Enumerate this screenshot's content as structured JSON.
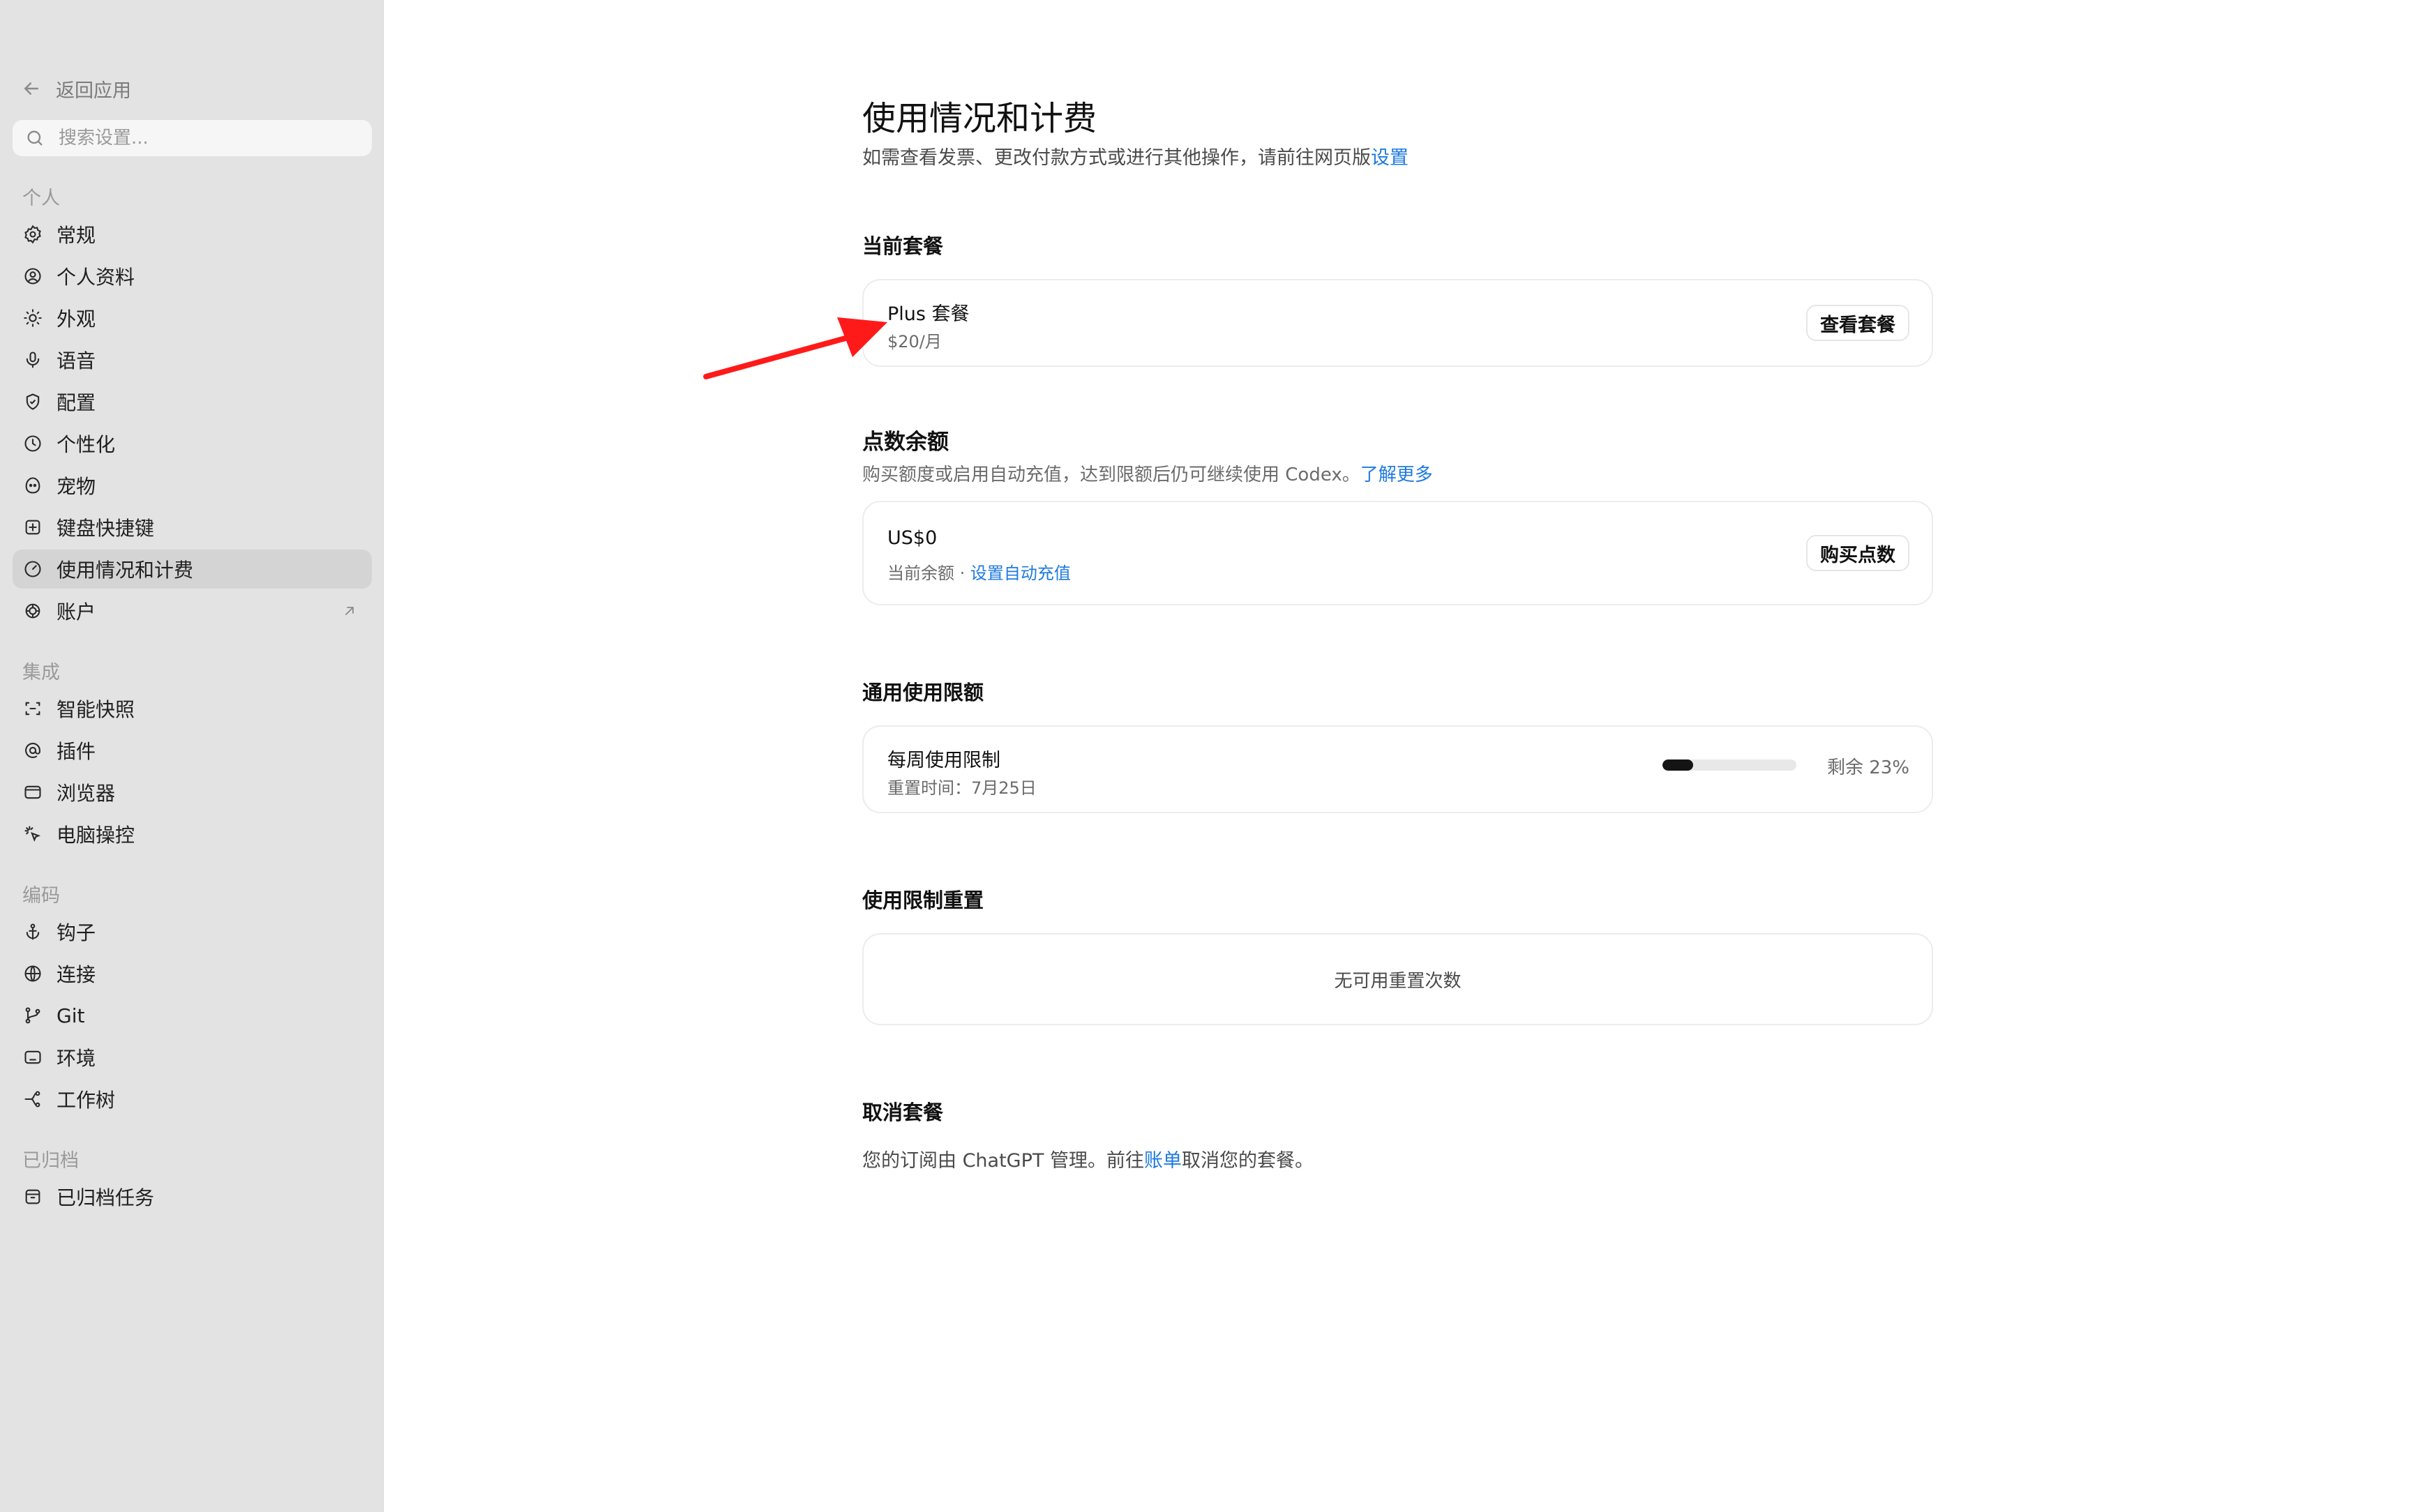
{
  "sidebar": {
    "back_label": "返回应用",
    "search_placeholder": "搜索设置...",
    "sections": {
      "personal": "个人",
      "integrations": "集成",
      "coding": "编码",
      "archived": "已归档"
    },
    "items": {
      "general": "常规",
      "profile": "个人资料",
      "appearance": "外观",
      "voice": "语音",
      "config": "配置",
      "personalization": "个性化",
      "pets": "宠物",
      "shortcuts": "键盘快捷键",
      "usage": "使用情况和计费",
      "account": "账户",
      "snapshots": "智能快照",
      "plugins": "插件",
      "browser": "浏览器",
      "computer_use": "电脑操控",
      "hooks": "钩子",
      "connections": "连接",
      "git": "Git",
      "environments": "环境",
      "worktrees": "工作树",
      "archived_tasks": "已归档任务"
    }
  },
  "main": {
    "title": "使用情况和计费",
    "subtitle": "如需查看发票、更改付款方式或进行其他操作，请前往网页版",
    "subtitle_link": "设置",
    "plan": {
      "heading": "当前套餐",
      "name": "Plus 套餐",
      "price": "$20/月",
      "button": "查看套餐"
    },
    "credits": {
      "heading": "点数余额",
      "desc": "购买额度或启用自动充值，达到限额后仍可继续使用 Codex。",
      "desc_link": "了解更多",
      "balance": "US$0",
      "balance_label": "当前余额 · ",
      "auto_link": "设置自动充值",
      "button": "购买点数"
    },
    "limits": {
      "heading": "通用使用限额",
      "weekly_title": "每周使用限制",
      "reset_label": "重置时间：7月25日",
      "remaining_label": "剩余 23%",
      "used_fraction": 0.23
    },
    "resets": {
      "heading": "使用限制重置",
      "empty": "无可用重置次数"
    },
    "cancel": {
      "heading": "取消套餐",
      "text_before": "您的订阅由 ChatGPT 管理。前往",
      "link": "账单",
      "text_after": "取消您的套餐。"
    }
  },
  "colors": {
    "link": "#1f7ae0",
    "annotation_arrow": "#ff1a1a",
    "sidebar_bg": "#e3e3e3"
  }
}
